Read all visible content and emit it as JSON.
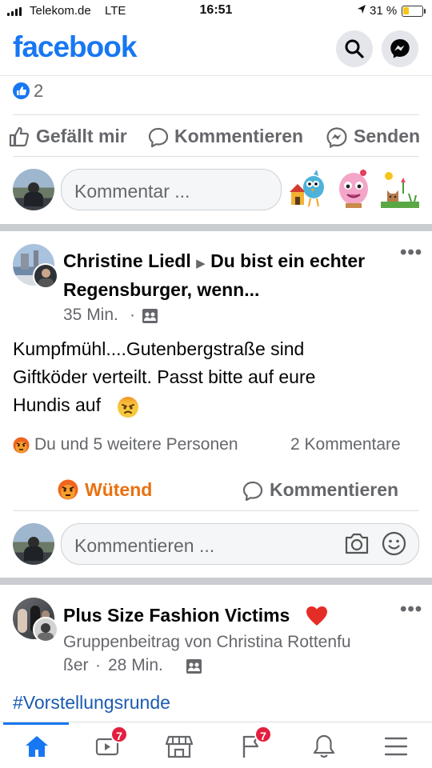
{
  "status_bar": {
    "carrier": "Telekom.de",
    "network": "LTE",
    "time": "16:51",
    "battery": "31 %"
  },
  "header": {
    "logo": "facebook",
    "search_icon": "search-icon",
    "messenger_icon": "messenger-icon"
  },
  "post1": {
    "like_count": "2",
    "actions": {
      "like": "Gefällt mir",
      "comment": "Kommentieren",
      "send": "Senden"
    },
    "comment_placeholder": "Kommentar ...",
    "stickers": [
      "bird-sticker",
      "pink-monster-sticker",
      "cat-sticker"
    ]
  },
  "post2": {
    "author": "Christine Liedl",
    "arrow": "▶",
    "group": "Du bist ein echter Regensburger, wenn...",
    "time": "35 Min.",
    "dot": "·",
    "text_line1": "Kumpfmühl....Gutenbergstraße sind",
    "text_line2": "Giftköder verteilt. Passt bitte auf eure",
    "text_line3": "Hundis auf",
    "reactions": "Du und 5 weitere Personen",
    "comments_count": "2 Kommentare",
    "actions": {
      "angry": "Wütend",
      "comment": "Kommentieren"
    },
    "comment_placeholder": "Kommentieren ...",
    "angry_color": "#e9710f"
  },
  "post3": {
    "title": "Plus Size Fashion Victims",
    "subtitle_line1": "Gruppenbeitrag von Christina Rottenfu",
    "subtitle_line2": "ßer",
    "time": "28 Min.",
    "dot": "·",
    "hashtag": "#Vorstellungsrunde"
  },
  "tabbar": {
    "video_badge": "7",
    "pages_badge": "7"
  },
  "colors": {
    "brand": "#1877f2",
    "badge": "#e41e3f"
  }
}
